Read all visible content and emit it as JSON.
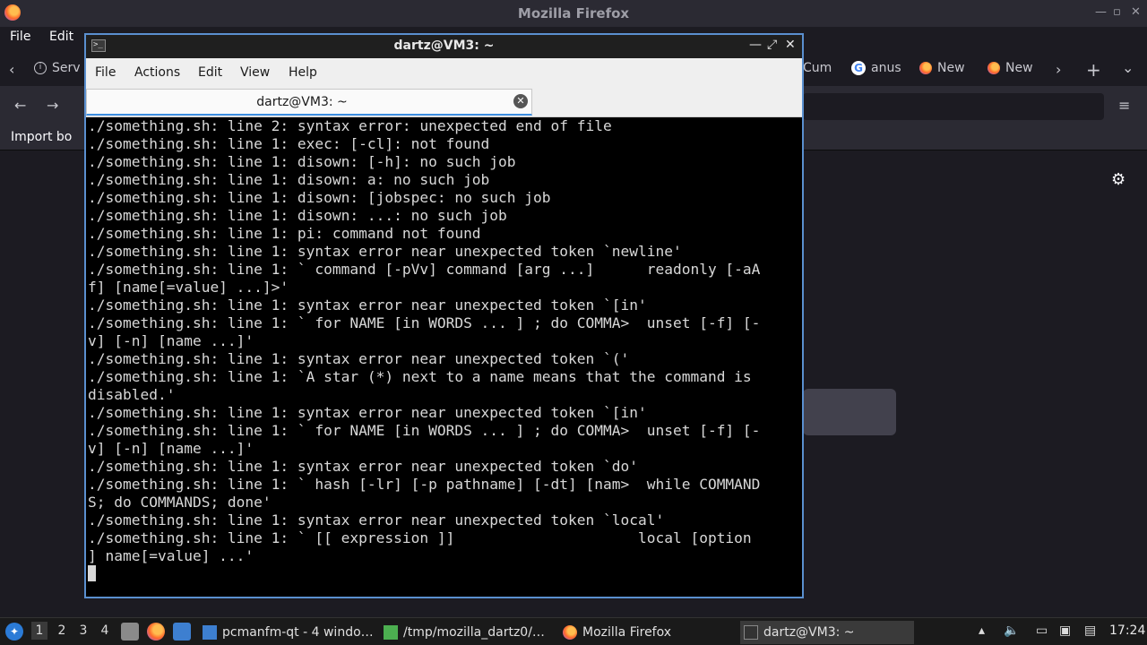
{
  "firefox": {
    "window_title": "Mozilla Firefox",
    "menu": [
      "File",
      "Edit"
    ],
    "tabs": [
      {
        "label": "Serv"
      },
      {
        "label": "Cum"
      },
      {
        "label": "anus"
      },
      {
        "label": "New"
      },
      {
        "label": "New"
      }
    ],
    "bookmarks_label": "Import bo"
  },
  "terminal": {
    "title": "dartz@VM3: ~",
    "menu": [
      "File",
      "Actions",
      "Edit",
      "View",
      "Help"
    ],
    "tab_label": "dartz@VM3: ~",
    "lines": [
      "./something.sh: line 2: syntax error: unexpected end of file",
      "./something.sh: line 1: exec: [-cl]: not found",
      "./something.sh: line 1: disown: [-h]: no such job",
      "./something.sh: line 1: disown: a: no such job",
      "./something.sh: line 1: disown: [jobspec: no such job",
      "./something.sh: line 1: disown: ...: no such job",
      "./something.sh: line 1: pi: command not found",
      "./something.sh: line 1: syntax error near unexpected token `newline'",
      "./something.sh: line 1: ` command [-pVv] command [arg ...]      readonly [-aA",
      "f] [name[=value] ...]>'",
      "./something.sh: line 1: syntax error near unexpected token `[in'",
      "./something.sh: line 1: ` for NAME [in WORDS ... ] ; do COMMA>  unset [-f] [-",
      "v] [-n] [name ...]'",
      "./something.sh: line 1: syntax error near unexpected token `('",
      "./something.sh: line 1: `A star (*) next to a name means that the command is",
      "disabled.'",
      "./something.sh: line 1: syntax error near unexpected token `[in'",
      "./something.sh: line 1: ` for NAME [in WORDS ... ] ; do COMMA>  unset [-f] [-",
      "v] [-n] [name ...]'",
      "./something.sh: line 1: syntax error near unexpected token `do'",
      "./something.sh: line 1: ` hash [-lr] [-p pathname] [-dt] [nam>  while COMMAND",
      "S; do COMMANDS; done'",
      "./something.sh: line 1: syntax error near unexpected token `local'",
      "./something.sh: line 1: ` [[ expression ]]                     local [option",
      "] name[=value] ...'"
    ]
  },
  "taskbar": {
    "desktops": [
      "1",
      "2",
      "3",
      "4"
    ],
    "tasks": [
      {
        "label": "pcmanfm-qt - 4 windo…"
      },
      {
        "label": "/tmp/mozilla_dartz0/…"
      },
      {
        "label": "Mozilla Firefox"
      },
      {
        "label": "dartz@VM3: ~"
      }
    ],
    "clock": "17:24"
  }
}
